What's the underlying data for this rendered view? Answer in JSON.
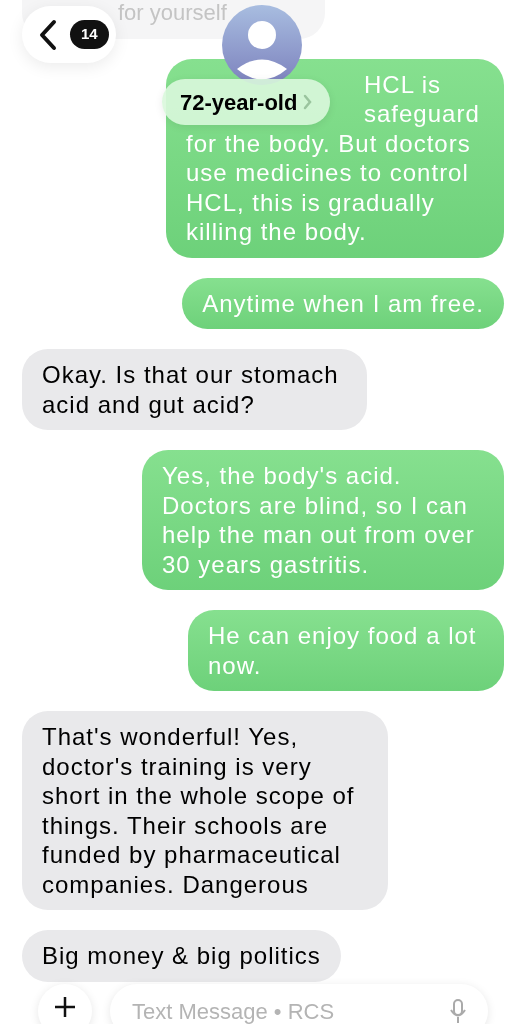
{
  "header": {
    "back_count": "14",
    "contact_name": "72-year-old"
  },
  "messages": [
    {
      "kind": "received",
      "faded": true,
      "text": "for yourself"
    },
    {
      "kind": "sent",
      "faded": false,
      "fragments": [
        "HCL is",
        "safeguard"
      ],
      "text": "for the body. But doctors use medicines to control HCL, this is gradually killing the body."
    },
    {
      "kind": "sent",
      "faded": false,
      "text": "Anytime when I am free."
    },
    {
      "kind": "received",
      "faded": false,
      "text": "Okay. Is that our stomach acid and gut acid?"
    },
    {
      "kind": "sent",
      "faded": false,
      "text": "Yes, the body's acid. Doctors are blind, so I can help the man out from over 30 years gastritis."
    },
    {
      "kind": "sent",
      "faded": false,
      "text": "He can enjoy food a lot now."
    },
    {
      "kind": "received",
      "faded": false,
      "text": "That's wonderful! Yes, doctor's training is very short in the whole scope of things. Their schools are funded by pharmaceutical companies. Dangerous"
    },
    {
      "kind": "received",
      "faded": false,
      "text": "Big money & big politics"
    }
  ],
  "composer": {
    "placeholder": "Text Message • RCS"
  }
}
